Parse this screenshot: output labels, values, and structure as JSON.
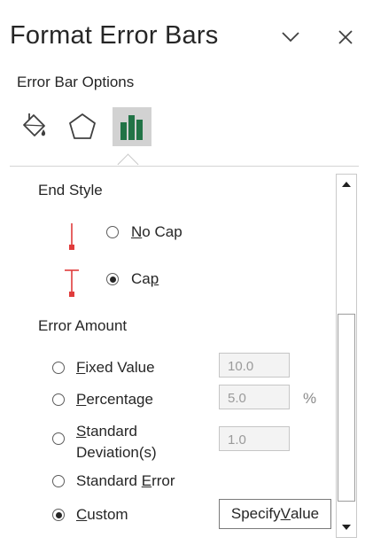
{
  "panel": {
    "title": "Format Error Bars",
    "collapse_icon": "chevron-down-icon",
    "close_icon": "close-icon"
  },
  "options": {
    "label": "Error Bar Options",
    "tabs": [
      {
        "name": "fill-line-tab",
        "icon": "paint-bucket-icon",
        "selected": false
      },
      {
        "name": "effects-tab",
        "icon": "pentagon-icon",
        "selected": false
      },
      {
        "name": "error-bar-options-tab",
        "icon": "bar-chart-icon",
        "selected": true
      }
    ]
  },
  "end_style": {
    "heading": "End Style",
    "no_cap": {
      "pre": "",
      "mnemonic": "N",
      "post": "o Cap",
      "checked": false
    },
    "cap": {
      "pre": "Ca",
      "mnemonic": "p",
      "post": "",
      "checked": true
    },
    "preview_color": "#e03c3c"
  },
  "error_amount": {
    "heading": "Error Amount",
    "fixed_value": {
      "mnemonic": "F",
      "post": "ixed Value",
      "value": "10.0",
      "checked": false
    },
    "percentage": {
      "mnemonic": "P",
      "post": "ercentage",
      "value": "5.0",
      "unit": "%",
      "checked": false
    },
    "std_dev": {
      "line1_mnemonic": "S",
      "line1_post": "tandard",
      "line2": "Deviation(s)",
      "value": "1.0",
      "checked": false
    },
    "std_error": {
      "pre": "Standard ",
      "mnemonic": "E",
      "post": "rror",
      "checked": false
    },
    "custom": {
      "pre": "",
      "mnemonic": "C",
      "post": "ustom",
      "checked": true
    },
    "specify_button": {
      "pre": "Specify ",
      "mnemonic": "V",
      "post": "alue"
    }
  },
  "colors": {
    "accent_green": "#217346",
    "selected_tab_bg": "#d2d2d2"
  }
}
